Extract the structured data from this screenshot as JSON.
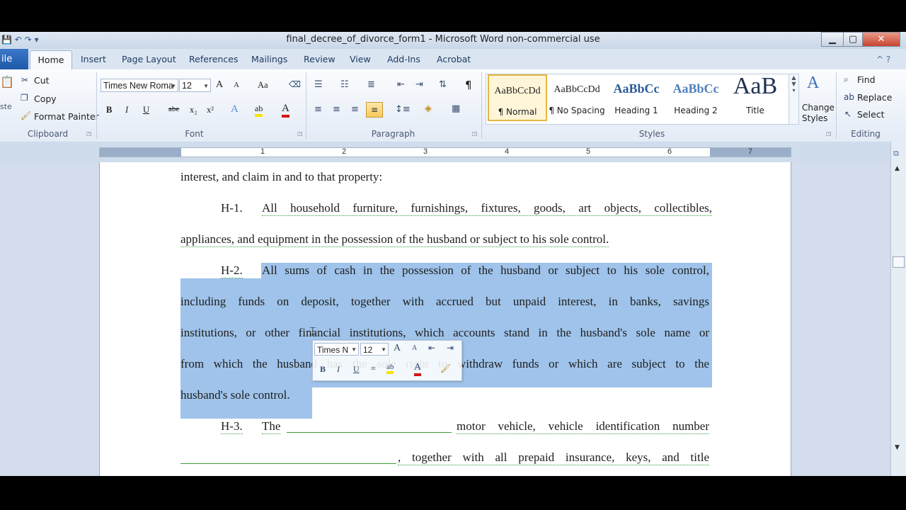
{
  "window": {
    "title": "final_decree_of_divorce_form1 - Microsoft Word non-commercial use",
    "qat_icons": [
      "save-icon",
      "undo-icon",
      "redo-icon",
      "customize-icon"
    ],
    "minimize": "▁",
    "maximize": "▢",
    "close": "✕"
  },
  "tabs": {
    "file": "ile",
    "active": "Home",
    "items": [
      "Insert",
      "Page Layout",
      "References",
      "Mailings",
      "Review",
      "View",
      "Add-Ins",
      "Acrobat"
    ],
    "help": "^ ?"
  },
  "clipboard": {
    "paste": "ste",
    "cut": "Cut",
    "copy": "Copy",
    "format_painter": "Format Painter",
    "label": "Clipboard"
  },
  "font": {
    "name": "Times New Roma",
    "size": "12",
    "grow": "A",
    "shrink": "A",
    "case": "Aa",
    "bold": "B",
    "italic": "I",
    "underline": "U",
    "strike": "abe",
    "subscript": "x₂",
    "superscript": "x²",
    "effects": "A",
    "highlight": "ab",
    "color": "A",
    "label": "Font"
  },
  "paragraph": {
    "show_marks": "¶",
    "label": "Paragraph"
  },
  "styles": {
    "items": [
      {
        "sample": "AaBbCcDd",
        "name": "¶ Normal"
      },
      {
        "sample": "AaBbCcDd",
        "name": "¶ No Spacing"
      },
      {
        "sample": "AaBbCc",
        "name": "Heading 1"
      },
      {
        "sample": "AaBbCc",
        "name": "Heading 2"
      },
      {
        "sample": "AaB",
        "name": "Title"
      }
    ],
    "change_styles": "Change Styles",
    "label": "Styles"
  },
  "editing": {
    "find": "Find",
    "replace": "Replace",
    "select": "Select",
    "label": "Editing"
  },
  "ruler": {
    "numbers": [
      "1",
      "2",
      "3",
      "4",
      "5",
      "6",
      "7"
    ]
  },
  "document": {
    "line1": "interest, and claim in and to that property:",
    "h1_label": "H-1.",
    "h1_line1": "All household furniture, furnishings, fixtures, goods, art objects, collectibles,",
    "h1_line2": "appliances, and equipment in the possession of the husband or subject to his sole control.",
    "h2_label": "H-2.",
    "h2_line1": "All sums of cash in the possession of the husband or subject to his sole control,",
    "h2_line2": "including funds on deposit, together with accrued but unpaid interest, in banks, savings",
    "h2_line3": "institutions, or other financial institutions, which accounts stand in the husband's sole name or",
    "h2_line4": "from which the husband has the sole right to withdraw funds or which are subject to the",
    "h2_line5": "husband's sole control.",
    "h3_label": "H-3.",
    "h3_the": "The",
    "h3_line1_end": "motor vehicle, vehicle identification number",
    "h3_line2_end": ", together with all prepaid insurance, keys, and title"
  },
  "mini_toolbar": {
    "font": "Times N",
    "size": "12"
  },
  "colors": {
    "selection": "#9fc3ea",
    "ribbon_tab_bg": "#dbe5f1",
    "file_tab": "#2b67b8",
    "workspace": "#d3ddec",
    "highlight_yellow": "#f5e400",
    "font_red": "#d01818"
  }
}
